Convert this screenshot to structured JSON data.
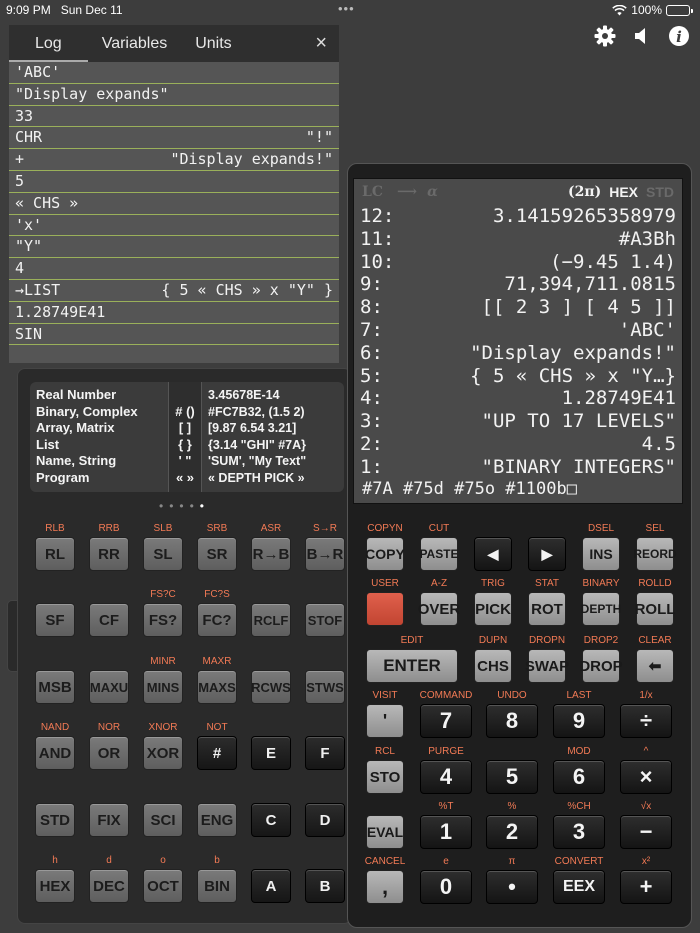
{
  "status": {
    "time": "9:09 PM",
    "date": "Sun Dec 11",
    "dots": "•••",
    "battery": "100%"
  },
  "top_icons": [
    "gear-icon",
    "speaker-icon",
    "info-icon"
  ],
  "log": {
    "tabs": [
      "Log",
      "Variables",
      "Units"
    ],
    "close": "×",
    "lines": [
      {
        "l": "'ABC'",
        "r": ""
      },
      {
        "l": "\"Display expands\"",
        "r": ""
      },
      {
        "l": "33",
        "r": ""
      },
      {
        "l": "CHR",
        "r": "\"!\""
      },
      {
        "l": "+",
        "r": "\"Display expands!\""
      },
      {
        "l": "5",
        "r": ""
      },
      {
        "l": "« CHS »",
        "r": ""
      },
      {
        "l": "'x'",
        "r": ""
      },
      {
        "l": "\"Y\"",
        "r": ""
      },
      {
        "l": "4",
        "r": ""
      },
      {
        "l": "→LIST",
        "r": "{ 5 « CHS » x \"Y\" }"
      },
      {
        "l": "1.28749E41",
        "r": ""
      },
      {
        "l": "SIN",
        "r": ""
      }
    ]
  },
  "ref_card": {
    "col1": [
      "Real Number",
      "Binary, Complex",
      "Array, Matrix",
      "List",
      "Name, String",
      "Program"
    ],
    "col2": [
      "",
      "# ()",
      "[ ]",
      "{ }",
      "' \"",
      "« »"
    ],
    "col3": [
      "3.45678E-14",
      "#FC7B32, (1.5 2)",
      "[9.87 6.54 3.21]",
      "{3.14 \"GHI\" #7A}",
      "'SUM', \"My Text\"",
      "« DEPTH PICK »"
    ]
  },
  "page_dots": [
    "•",
    "•",
    "•",
    "•",
    "•"
  ],
  "left_keys": [
    [
      {
        "k": "RL",
        "s": "RLB"
      },
      {
        "k": "RR",
        "s": "RRB"
      },
      {
        "k": "SL",
        "s": "SLB"
      },
      {
        "k": "SR",
        "s": "SRB"
      },
      {
        "k": "R→B",
        "s": "ASR"
      },
      {
        "k": "B→R",
        "s": "S→R"
      }
    ],
    [
      {
        "k": "SF",
        "s": ""
      },
      {
        "k": "CF",
        "s": ""
      },
      {
        "k": "FS?",
        "s": "FS?C"
      },
      {
        "k": "FC?",
        "s": "FC?S"
      },
      {
        "k": "RCLF",
        "s": ""
      },
      {
        "k": "STOF",
        "s": ""
      }
    ],
    [
      {
        "k": "MSB",
        "s": ""
      },
      {
        "k": "MAXU",
        "s": ""
      },
      {
        "k": "MINS",
        "s": "MINR"
      },
      {
        "k": "MAXS",
        "s": "MAXR"
      },
      {
        "k": "RCWS",
        "s": ""
      },
      {
        "k": "STWS",
        "s": ""
      }
    ],
    [
      {
        "k": "AND",
        "s": "NAND"
      },
      {
        "k": "OR",
        "s": "NOR"
      },
      {
        "k": "XOR",
        "s": "XNOR"
      },
      {
        "k": "#",
        "s": "NOT"
      },
      {
        "k": "E",
        "s": ""
      },
      {
        "k": "F",
        "s": ""
      }
    ],
    [
      {
        "k": "STD",
        "s": ""
      },
      {
        "k": "FIX",
        "s": ""
      },
      {
        "k": "SCI",
        "s": ""
      },
      {
        "k": "ENG",
        "s": ""
      },
      {
        "k": "C",
        "s": ""
      },
      {
        "k": "D",
        "s": ""
      }
    ],
    [
      {
        "k": "HEX",
        "s": "h"
      },
      {
        "k": "DEC",
        "s": "d"
      },
      {
        "k": "OCT",
        "s": "o"
      },
      {
        "k": "BIN",
        "s": "b"
      },
      {
        "k": "A",
        "s": ""
      },
      {
        "k": "B",
        "s": ""
      }
    ]
  ],
  "screen": {
    "annunciators": [
      "LC",
      "⟶",
      "α",
      "(2π)",
      "HEX",
      "STD"
    ],
    "stack": [
      {
        "lvl": "12:",
        "val": "3.14159265358979"
      },
      {
        "lvl": "11:",
        "val": "#A3Bh"
      },
      {
        "lvl": "10:",
        "val": "(−9.45 1.4)"
      },
      {
        "lvl": "9:",
        "val": "71,394,711.0815"
      },
      {
        "lvl": "8:",
        "val": "[[ 2 3 ] [ 4 5 ]]"
      },
      {
        "lvl": "7:",
        "val": "'ABC'"
      },
      {
        "lvl": "6:",
        "val": "\"Display expands!\""
      },
      {
        "lvl": "5:",
        "val": "{ 5 « CHS » x \"Y…}"
      },
      {
        "lvl": "4:",
        "val": "1.28749E41"
      },
      {
        "lvl": "3:",
        "val": "\"UP TO 17 LEVELS\""
      },
      {
        "lvl": "2:",
        "val": "4.5"
      },
      {
        "lvl": "1:",
        "val": "\"BINARY INTEGERS\""
      }
    ],
    "menu": "#7A #75d #75o #1100b□"
  },
  "right_keys": {
    "row1": [
      {
        "k": "COPY",
        "s": "COPYN"
      },
      {
        "k": "PASTE",
        "s": "CUT"
      },
      {
        "k": "◀",
        "s": ""
      },
      {
        "k": "▶",
        "s": ""
      },
      {
        "k": "INS",
        "s": "DSEL"
      },
      {
        "k": "REORD",
        "s": "SEL"
      }
    ],
    "row2": [
      {
        "k": "",
        "s": "USER"
      },
      {
        "k": "OVER",
        "s": "A-Z"
      },
      {
        "k": "PICK",
        "s": "TRIG"
      },
      {
        "k": "ROT",
        "s": "STAT"
      },
      {
        "k": "DEPTH",
        "s": "BINARY"
      },
      {
        "k": "ROLL",
        "s": "ROLLD"
      }
    ],
    "row3": [
      {
        "k": "ENTER",
        "s": "EDIT"
      },
      {
        "k": "CHS",
        "s": "DUPN"
      },
      {
        "k": "SWAP",
        "s": "DROPN"
      },
      {
        "k": "DROP",
        "s": "DROP2"
      },
      {
        "k": "⬅",
        "s": "CLEAR"
      }
    ],
    "row4": [
      {
        "k": "'",
        "s": "VISIT"
      },
      {
        "k": "7",
        "s": "COMMAND"
      },
      {
        "k": "8",
        "s": "UNDO"
      },
      {
        "k": "9",
        "s": "LAST"
      },
      {
        "k": "÷",
        "s": "1/x"
      }
    ],
    "row5": [
      {
        "k": "STO",
        "s": "RCL"
      },
      {
        "k": "4",
        "s": "PURGE"
      },
      {
        "k": "5",
        "s": ""
      },
      {
        "k": "6",
        "s": "MOD"
      },
      {
        "k": "×",
        "s": "^"
      }
    ],
    "row6": [
      {
        "k": "EVAL",
        "s": ""
      },
      {
        "k": "1",
        "s": "%T"
      },
      {
        "k": "2",
        "s": "%"
      },
      {
        "k": "3",
        "s": "%CH"
      },
      {
        "k": "−",
        "s": "√x"
      }
    ],
    "row7": [
      {
        "k": ",",
        "s": "CANCEL"
      },
      {
        "k": "0",
        "s": "e"
      },
      {
        "k": "•",
        "s": "π"
      },
      {
        "k": "EEX",
        "s": "CONVERT"
      },
      {
        "k": "+",
        "s": "x²"
      }
    ]
  }
}
